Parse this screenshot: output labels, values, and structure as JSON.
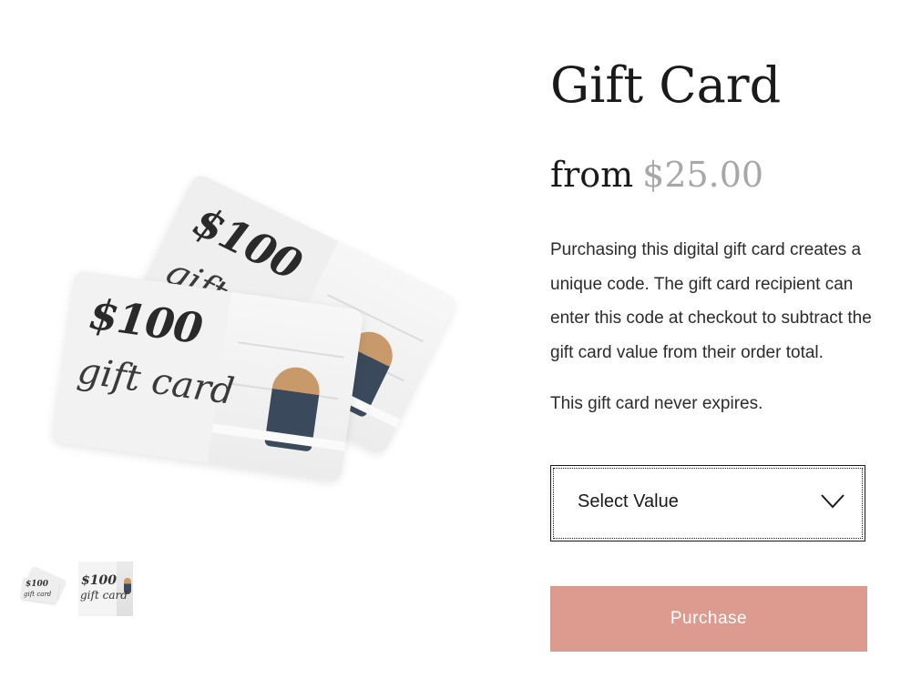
{
  "product": {
    "title": "Gift Card",
    "price_prefix": "from",
    "price": "$25.00",
    "description": "Purchasing this digital gift card creates a unique code. The gift card recipient can enter this code at checkout to subtract the gift card value from their order total.",
    "note": "This gift card never expires."
  },
  "gallery": {
    "card_amount": "$100",
    "card_script": "gift card",
    "thumb_amount": "$100",
    "thumb_script": "gift card"
  },
  "value_select": {
    "label": "Select Value",
    "icon": "chevron-down-icon"
  },
  "purchase_button": {
    "label": "Purchase",
    "color": "#dd9a8e"
  },
  "colors": {
    "price_muted": "#a7a7a7",
    "text": "#1a1a1a"
  }
}
